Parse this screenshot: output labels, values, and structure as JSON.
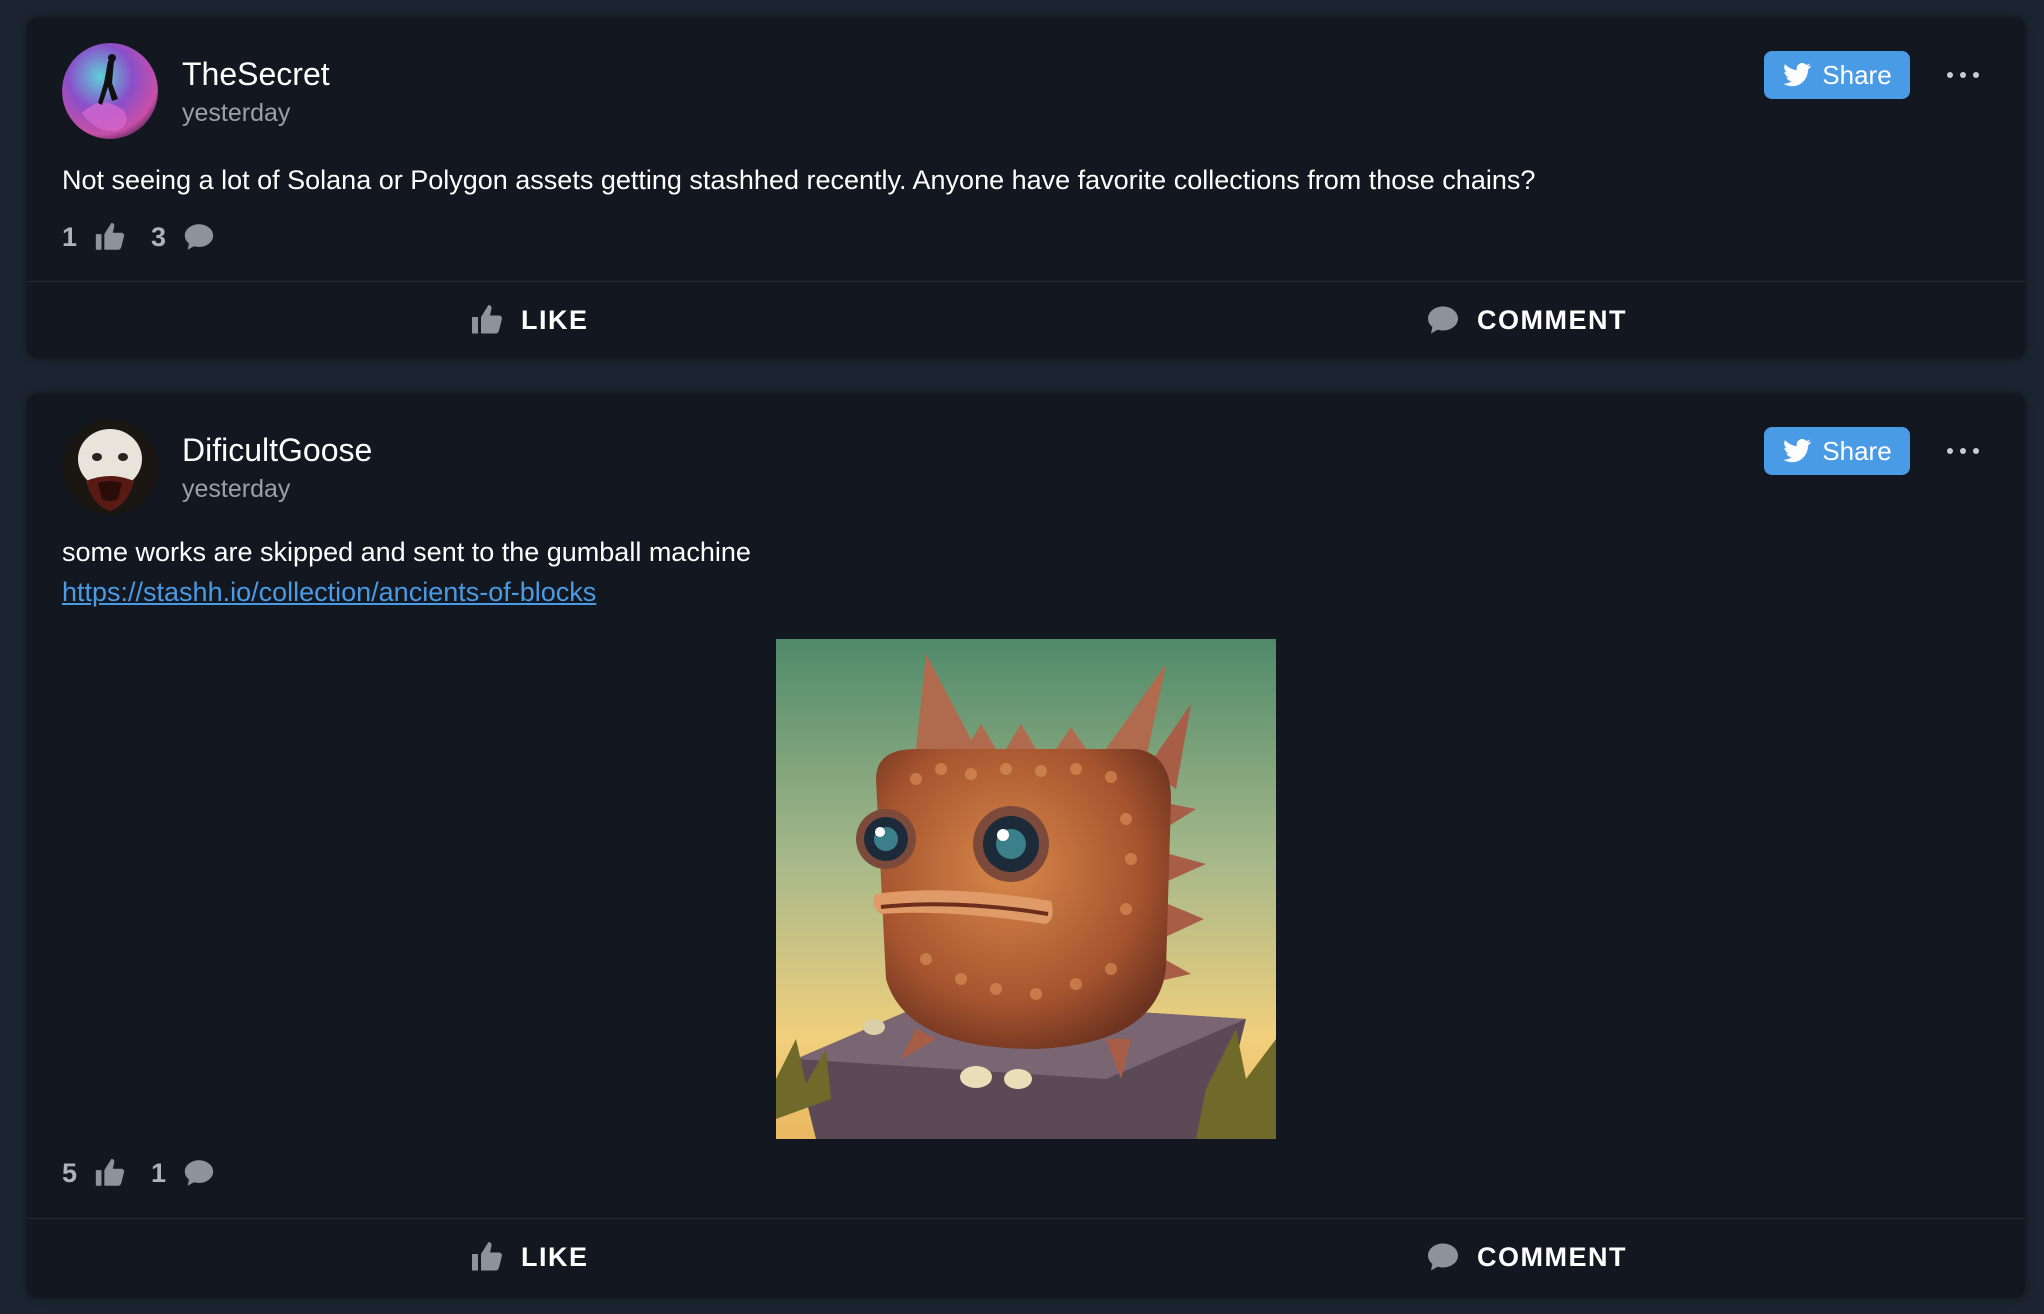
{
  "posts": [
    {
      "username": "TheSecret",
      "time": "yesterday",
      "share_label": "Share",
      "text": "Not seeing a lot of Solana or Polygon assets getting stashhed recently. Anyone have favorite collections from those chains?",
      "likes": "1",
      "comments": "3",
      "like_label": "LIKE",
      "comment_label": "COMMENT"
    },
    {
      "username": "DificultGoose",
      "time": "yesterday",
      "share_label": "Share",
      "text": "some works are skipped and sent to the gumball machine",
      "link": "https://stashh.io/collection/ancients-of-blocks",
      "likes": "5",
      "comments": "1",
      "like_label": "LIKE",
      "comment_label": "COMMENT"
    }
  ],
  "icons": {
    "share": "twitter-bird-icon",
    "more": "more-horizontal-icon",
    "like": "thumbs-up-icon",
    "comment": "comment-bubble-icon"
  },
  "colors": {
    "background": "#1c2431",
    "card": "#121720",
    "share_button": "#4a9be5",
    "link": "#4a9be5"
  }
}
